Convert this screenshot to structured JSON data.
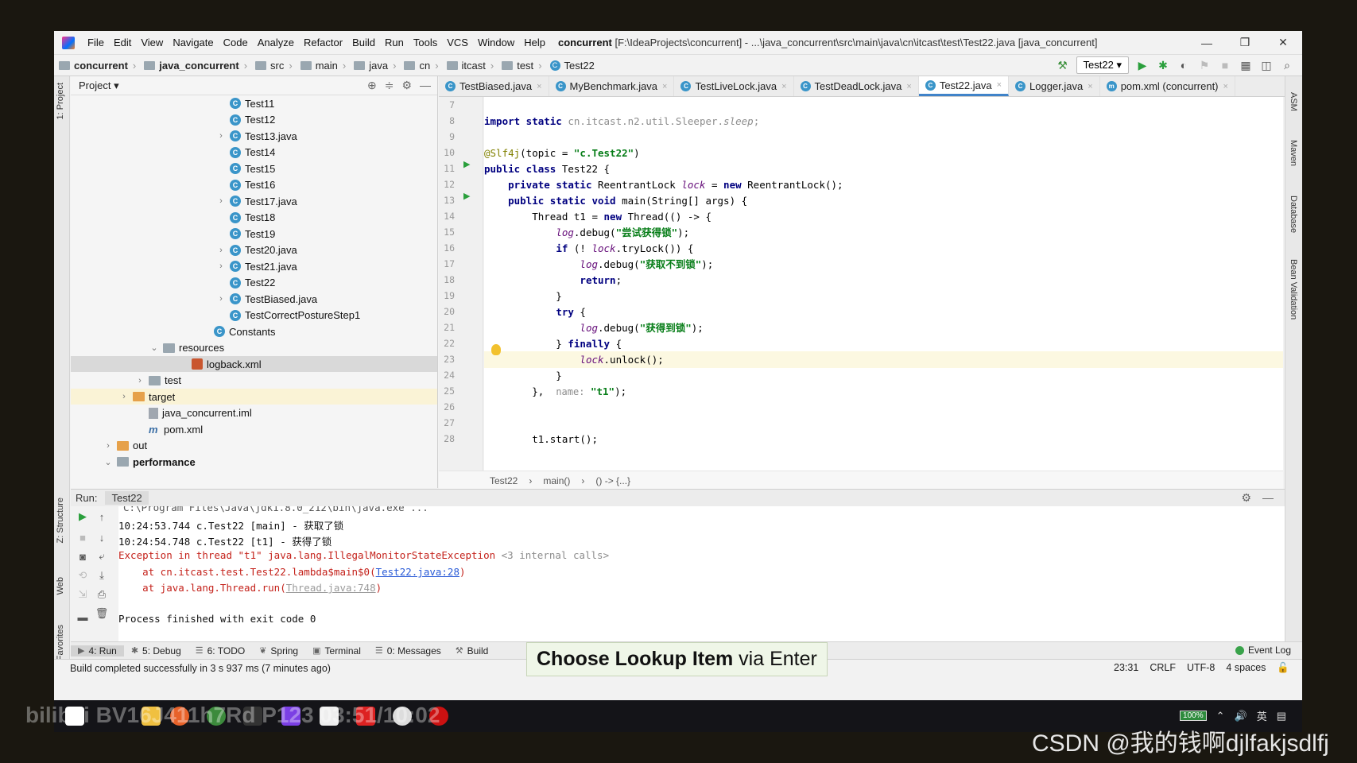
{
  "menu": {
    "items": [
      "File",
      "Edit",
      "View",
      "Navigate",
      "Code",
      "Analyze",
      "Refactor",
      "Build",
      "Run",
      "Tools",
      "VCS",
      "Window",
      "Help"
    ],
    "title_bold": "concurrent",
    "title_rest": "[F:\\IdeaProjects\\concurrent] - ...\\java_concurrent\\src\\main\\java\\cn\\itcast\\test\\Test22.java [java_concurrent]"
  },
  "window_controls": {
    "minimize": "—",
    "restore": "❐",
    "close": "✕"
  },
  "breadcrumb": {
    "items": [
      "concurrent",
      "java_concurrent",
      "src",
      "main",
      "java",
      "cn",
      "itcast",
      "test",
      "Test22"
    ],
    "run_config": "Test22 ▾"
  },
  "sidebar_stripe": {
    "project": "1: Project",
    "structure": "Z: Structure",
    "web": "Web",
    "favorites": "2: Favorites"
  },
  "right_stripe": {
    "ant": "ASM",
    "maven": "Maven",
    "database": "Database",
    "bean": "Bean Validation"
  },
  "project_panel": {
    "title": "Project ▾",
    "rows": [
      {
        "label": "Test11",
        "icon": "class-icon",
        "arrow": ""
      },
      {
        "label": "Test12",
        "icon": "class-icon",
        "arrow": ""
      },
      {
        "label": "Test13.java",
        "icon": "class-icon",
        "arrow": "›"
      },
      {
        "label": "Test14",
        "icon": "class-icon",
        "arrow": ""
      },
      {
        "label": "Test15",
        "icon": "class-icon",
        "arrow": ""
      },
      {
        "label": "Test16",
        "icon": "class-icon",
        "arrow": ""
      },
      {
        "label": "Test17.java",
        "icon": "class-icon",
        "arrow": "›"
      },
      {
        "label": "Test18",
        "icon": "class-icon",
        "arrow": ""
      },
      {
        "label": "Test19",
        "icon": "class-icon",
        "arrow": ""
      },
      {
        "label": "Test20.java",
        "icon": "class-icon",
        "arrow": "›"
      },
      {
        "label": "Test21.java",
        "icon": "class-icon",
        "arrow": "›"
      },
      {
        "label": "Test22",
        "icon": "class-icon",
        "arrow": ""
      },
      {
        "label": "TestBiased.java",
        "icon": "class-icon",
        "arrow": "›"
      },
      {
        "label": "TestCorrectPostureStep1",
        "icon": "class-icon",
        "arrow": ""
      },
      {
        "label": "Constants",
        "icon": "class-icon",
        "arrow": ""
      },
      {
        "label": "resources",
        "icon": "folder-icon",
        "arrow": "⌄"
      },
      {
        "label": "logback.xml",
        "icon": "xml-icon",
        "arrow": ""
      },
      {
        "label": "test",
        "icon": "folder-icon",
        "arrow": "›"
      },
      {
        "label": "target",
        "icon": "orange-folder-icon",
        "arrow": "›"
      },
      {
        "label": "java_concurrent.iml",
        "icon": "iml-icon",
        "arrow": ""
      },
      {
        "label": "pom.xml",
        "icon": "maven-icon",
        "arrow": ""
      },
      {
        "label": "out",
        "icon": "orange-folder-icon",
        "arrow": "›"
      },
      {
        "label": "performance",
        "icon": "folder-icon",
        "arrow": "⌄"
      }
    ]
  },
  "tabs": [
    {
      "label": "TestBiased.java",
      "active": false
    },
    {
      "label": "MyBenchmark.java",
      "active": false
    },
    {
      "label": "TestLiveLock.java",
      "active": false
    },
    {
      "label": "TestDeadLock.java",
      "active": false
    },
    {
      "label": "Test22.java",
      "active": true
    },
    {
      "label": "Logger.java",
      "active": false
    },
    {
      "label": "pom.xml (concurrent)",
      "active": false
    }
  ],
  "code": {
    "line_numbers": [
      "7",
      "8",
      "9",
      "10",
      "11",
      "12",
      "13",
      "14",
      "15",
      "16",
      "17",
      "18",
      "19",
      "20",
      "21",
      "22",
      "23",
      "24",
      "25",
      "26",
      "27",
      "28"
    ]
  },
  "editor_breadcrumb": [
    "Test22",
    "›",
    "main()",
    "›",
    "() -> {...}"
  ],
  "run_panel": {
    "label": "Run:",
    "tab": "Test22"
  },
  "console": {
    "cmd": "C:\\Program Files\\Java\\jdk1.8.0_212\\bin\\java.exe ...",
    "line1": "10:24:53.744 c.Test22 [main] - 获取了锁",
    "line2": "10:24:54.748 c.Test22 [t1] - 获得了锁",
    "exception": "Exception in thread \"t1\" java.lang.IllegalMonitorStateException",
    "internal": " <3 internal calls>",
    "at1_prefix": "    at cn.itcast.test.Test22.lambda$main$0(",
    "at1_link": "Test22.java:28",
    "at1_suffix": ")",
    "at2_prefix": "    at java.lang.Thread.run(",
    "at2_link": "Thread.java:748",
    "at2_suffix": ")",
    "finished": "Process finished with exit code 0"
  },
  "tooltip": {
    "bold": "Choose Lookup Item",
    "rest": " via Enter"
  },
  "bottom_tools": [
    {
      "label": "4: Run",
      "glyph": "▶",
      "active": true
    },
    {
      "label": "5: Debug",
      "glyph": "✱",
      "active": false
    },
    {
      "label": "6: TODO",
      "glyph": "☰",
      "active": false
    },
    {
      "label": "Spring",
      "glyph": "❦",
      "active": false
    },
    {
      "label": "Terminal",
      "glyph": "▣",
      "active": false
    },
    {
      "label": "0: Messages",
      "glyph": "☰",
      "active": false
    },
    {
      "label": "Build",
      "glyph": "⚒",
      "active": false
    }
  ],
  "event_log": "Event Log",
  "status": {
    "message": "Build completed successfully in 3 s 937 ms (7 minutes ago)",
    "position": "23:31",
    "line_sep": "CRLF",
    "encoding": "UTF-8",
    "indent": "4 spaces"
  },
  "taskbar": {
    "battery": "100%",
    "ime": "英"
  },
  "watermark_left": "bilibili BV16J411h7Rd P123 03:51/10:02",
  "watermark_right": "CSDN @我的钱啊djlfakjsdlfj"
}
